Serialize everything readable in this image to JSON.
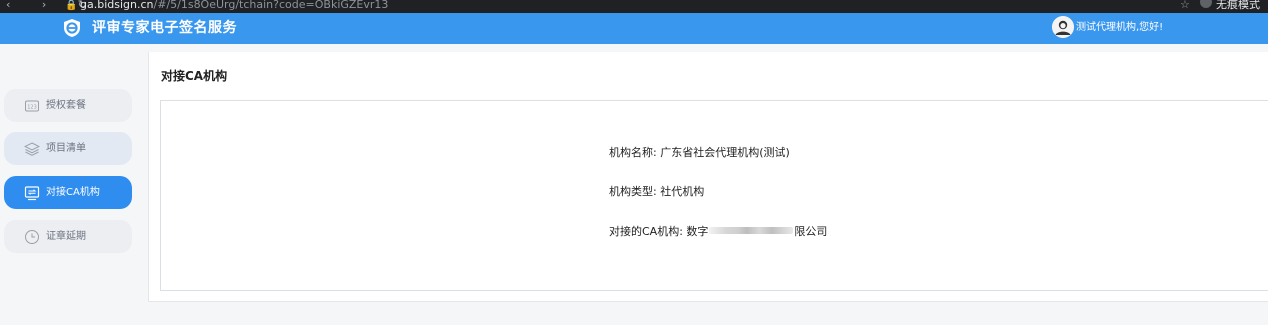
{
  "browser": {
    "url_host": "ga.bidsign.cn",
    "url_rest": "/#/5/1s8OeUrg/tchain?code=OBkiGZEvr13",
    "profile_label": "无痕模式"
  },
  "header": {
    "title": "评审专家电子签名服务",
    "greeting": "测试代理机构,您好!",
    "brand_color": "#3a97ee"
  },
  "sidebar": {
    "items": [
      {
        "label": "授权套餐",
        "icon": "package-icon",
        "state": "default"
      },
      {
        "label": "项目清单",
        "icon": "layers-icon",
        "state": "default"
      },
      {
        "label": "对接CA机构",
        "icon": "ca-connect-icon",
        "state": "active"
      },
      {
        "label": "证章延期",
        "icon": "clock-icon",
        "state": "default"
      }
    ],
    "active_color": "#2f8df0"
  },
  "main": {
    "title": "对接CA机构",
    "fields": {
      "org_name_label": "机构名称:",
      "org_name_value": "广东省社会代理机构(测试)",
      "org_type_label": "机构类型:",
      "org_type_value": "社代机构",
      "ca_label": "对接的CA机构:",
      "ca_value_start": "数字",
      "ca_value_end": "限公司"
    }
  }
}
